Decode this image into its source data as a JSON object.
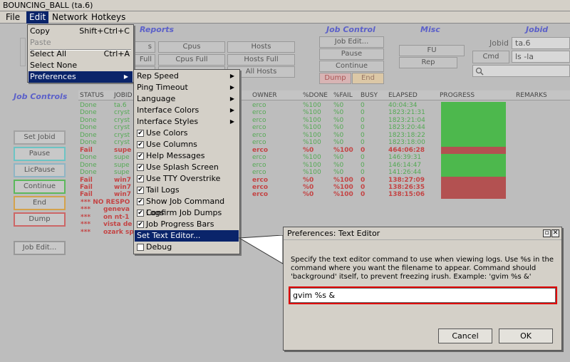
{
  "window": {
    "title": "BOUNCING_BALL (ta.6)"
  },
  "menubar": [
    {
      "label": "File"
    },
    {
      "label": "Edit"
    },
    {
      "label": "Network"
    },
    {
      "label": "Hotkeys"
    }
  ],
  "edit_menu": {
    "copy": {
      "label": "Copy",
      "accel": "Shift+Ctrl+C"
    },
    "paste": {
      "label": "Paste"
    },
    "select_all": {
      "label": "Select All",
      "accel": "Ctrl+A"
    },
    "select_none": {
      "label": "Select None"
    },
    "preferences": {
      "label": "Preferences"
    }
  },
  "preferences_menu": {
    "rep_speed": "Rep Speed",
    "ping_timeout": "Ping Timeout",
    "language": "Language",
    "interface_colors": "Interface Colors",
    "interface_styles": "Interface Styles",
    "use_colors": "Use Colors",
    "use_columns": "Use Columns",
    "help_messages": "Help Messages",
    "use_splash_screen": "Use Splash Screen",
    "use_tty_overstrike": "Use TTY Overstrike",
    "tail_logs": "Tail Logs",
    "show_job_command_logs": "Show Job Command Logs",
    "confirm_job_dumps": "Confirm Job Dumps",
    "job_progress_bars": "Job Progress Bars",
    "set_text_editor": "Set Text Editor...",
    "debug": "Debug"
  },
  "reports": {
    "title": "Reports",
    "b1": "s",
    "b2": "Cpus",
    "b3": "Hosts",
    "b4": "Full",
    "b5": "Cpus Full",
    "b6": "Hosts Full",
    "b9": "All Hosts"
  },
  "job_control": {
    "title": "Job Control",
    "job_edit": "Job Edit...",
    "pause": "Pause",
    "continue": "Continue",
    "dump": "Dump",
    "end": "End"
  },
  "misc": {
    "title": "Misc",
    "fu": "FU",
    "rep": "Rep"
  },
  "jobid": {
    "title": "Jobid",
    "label": "Jobid",
    "value": "ta.6",
    "cmd_label": "Cmd",
    "cmd_value": "ls -la"
  },
  "job_controls_side": {
    "title": "Job Controls",
    "set_jobid": "Set Jobid",
    "pause": "Pause",
    "licpause": "LicPause",
    "continue": "Continue",
    "end": "End",
    "dump": "Dump",
    "job_edit": "Job Edit..."
  },
  "table": {
    "headers": {
      "status": "STATUS",
      "jobid": "JOBID",
      "owner": "OWNER",
      "done": "%DONE",
      "fail": "%FAIL",
      "busy": "BUSY",
      "elapsed": "ELAPSED",
      "progress": "PROGRESS",
      "remarks": "REMARKS"
    },
    "rows": [
      {
        "status": "Done",
        "jobid": "ta.6",
        "owner": "erco",
        "done": "%100",
        "fail": "%0",
        "busy": "0",
        "elapsed": "40:04:34"
      },
      {
        "status": "Done",
        "jobid": "cryst",
        "owner": "erco",
        "done": "%100",
        "fail": "%0",
        "busy": "0",
        "elapsed": "1823:21:31"
      },
      {
        "status": "Done",
        "jobid": "cryst",
        "owner": "erco",
        "done": "%100",
        "fail": "%0",
        "busy": "0",
        "elapsed": "1823:21:04"
      },
      {
        "status": "Done",
        "jobid": "cryst",
        "owner": "erco",
        "done": "%100",
        "fail": "%0",
        "busy": "0",
        "elapsed": "1823:20:44"
      },
      {
        "status": "Done",
        "jobid": "cryst",
        "owner": "erco",
        "done": "%100",
        "fail": "%0",
        "busy": "0",
        "elapsed": "1823:18:22"
      },
      {
        "status": "Done",
        "jobid": "cryst",
        "owner": "erco",
        "done": "%100",
        "fail": "%0",
        "busy": "0",
        "elapsed": "1823:18:00"
      },
      {
        "status": "Fail",
        "jobid": "supe",
        "owner": "erco",
        "done": "%0",
        "fail": "%100",
        "busy": "0",
        "elapsed": "464:06:28"
      },
      {
        "status": "Done",
        "jobid": "supe",
        "owner": "erco",
        "done": "%100",
        "fail": "%0",
        "busy": "0",
        "elapsed": "146:39:31"
      },
      {
        "status": "Done",
        "jobid": "supe",
        "owner": "erco",
        "done": "%100",
        "fail": "%0",
        "busy": "0",
        "elapsed": "146:14:47"
      },
      {
        "status": "Done",
        "jobid": "supe",
        "owner": "erco",
        "done": "%100",
        "fail": "%0",
        "busy": "0",
        "elapsed": "141:26:44"
      },
      {
        "status": "Fail",
        "jobid": "win7",
        "owner": "erco",
        "done": "%0",
        "fail": "%100",
        "busy": "0",
        "elapsed": "138:27:09"
      },
      {
        "status": "Fail",
        "jobid": "win7",
        "owner": "erco",
        "done": "%0",
        "fail": "%100",
        "busy": "0",
        "elapsed": "138:26:35"
      },
      {
        "status": "Fail",
        "jobid": "win7",
        "owner": "erco",
        "done": "%0",
        "fail": "%100",
        "busy": "0",
        "elapsed": "138:15:06"
      }
    ],
    "notes": [
      {
        "a": "*** NO RESPO",
        "b": ""
      },
      {
        "a": "***",
        "b": "geneva"
      },
      {
        "a": "***",
        "b": "on nt-1"
      },
      {
        "a": "***",
        "b": "vista de"
      },
      {
        "a": "***",
        "b": "ozark sp"
      }
    ]
  },
  "dialog": {
    "title": "Preferences: Text Editor",
    "message": "Specify the text editor command to use when viewing logs. Use %s in the command where you want the filename to appear. Command should 'background' itself, to prevent freezing irush. Example: 'gvim %s &'",
    "value": "gvim %s &",
    "cancel": "Cancel",
    "ok": "OK"
  },
  "colors": {
    "done": "#55a955",
    "fail": "#c44444",
    "selection": "#0a246a",
    "highlight": "#e00000",
    "progress_done": "#4db84d",
    "progress_fail": "#b35151"
  }
}
